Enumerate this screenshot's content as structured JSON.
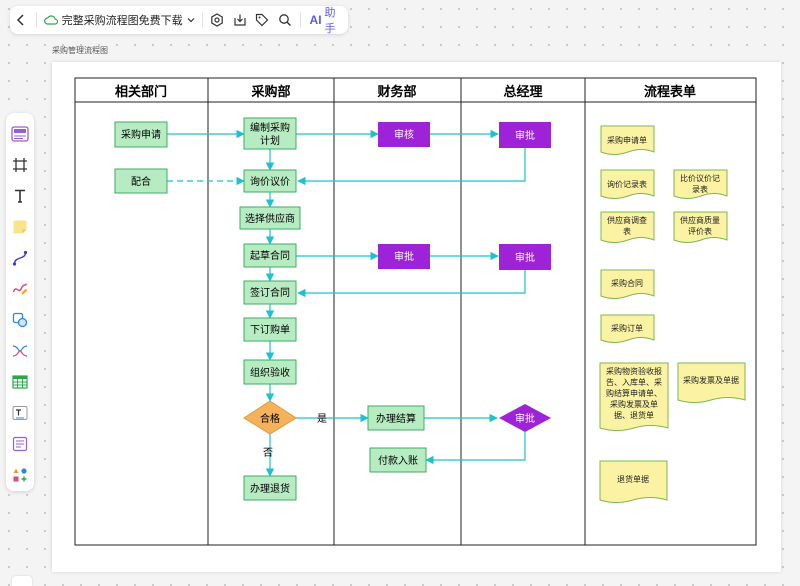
{
  "app": {
    "doc_title": "完整采购流程图免费下载",
    "ai_label": "AI",
    "ai_text": "助手",
    "canvas_label": "采购管理流程图"
  },
  "toolbar": [
    "sidebar-toggle-icon",
    "frame-icon",
    "text-icon",
    "sticky-note-icon",
    "connector-icon",
    "pen-icon",
    "shape-icon",
    "mindmap-icon",
    "table-icon",
    "text-box-icon",
    "list-icon",
    "more-apps-icon"
  ],
  "diagram": {
    "lanes": [
      "相关部门",
      "采购部",
      "财务部",
      "总经理",
      "流程表单"
    ],
    "nodes": {
      "purchase_request": "采购申请",
      "cooperate": "配合",
      "make_plan": "编制采购计划",
      "finance_review": "审核",
      "gm_approve_1": "审批",
      "inquiry": "询价议价",
      "select_supplier": "选择供应商",
      "draft_contract": "起草合同",
      "finance_approve": "审批",
      "gm_approve_2": "审批",
      "sign_contract": "签订合同",
      "place_order": "下订购单",
      "organize_acceptance": "组织验收",
      "qualified": "合格",
      "settlement": "办理结算",
      "gm_approve_3": "审批",
      "payment": "付款入账",
      "return_goods": "办理退货",
      "label_yes": "是",
      "label_no": "否"
    },
    "forms": {
      "f1": "采购申请单",
      "f2": "询价记录表",
      "f3": "比价议价记录表",
      "f4": "供应商调查表",
      "f5": "供应商质量评价表",
      "f6": "采购合同",
      "f7": "采购订单",
      "f8": "采购物资验收报告、入库单、采购结算申请单、采购发票及单据、退货单",
      "f9": "采购发票及单据",
      "f10": "退货单据"
    },
    "colors": {
      "process_fill": "#b7ebc2",
      "process_stroke": "#3fae63",
      "approve_fill": "#9e22d8",
      "decision_fill": "#f5b25a",
      "doc_fill": "#fbf3a3",
      "doc_stroke": "#7bb84e",
      "arrow": "#1cc3cf"
    }
  }
}
